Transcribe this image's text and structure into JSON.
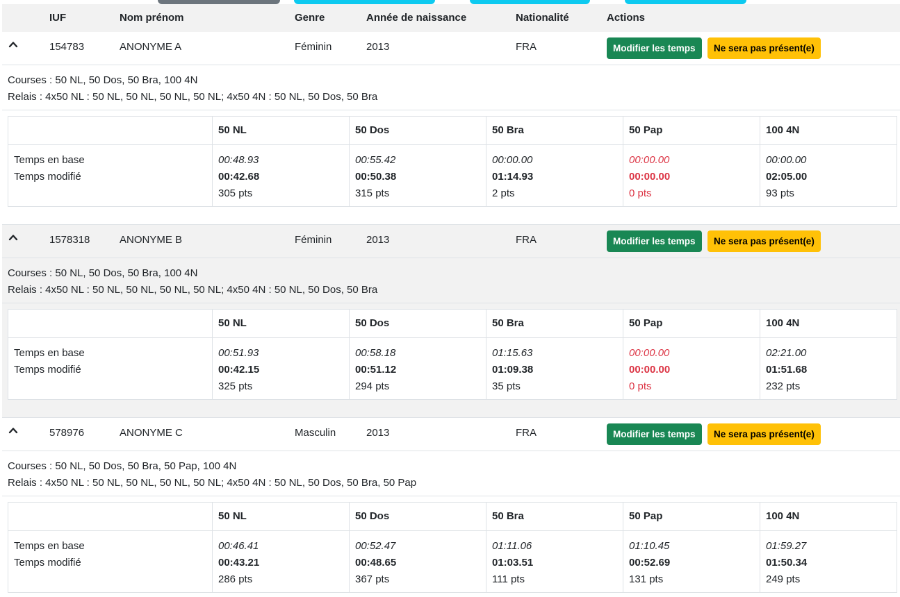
{
  "top_tabs": [
    {
      "color": "#6c757d"
    },
    {
      "color": "#0dcaf0"
    },
    {
      "color": "#0dcaf0"
    },
    {
      "color": "#0dcaf0"
    }
  ],
  "header": {
    "iuf": "IUF",
    "name": "Nom prénom",
    "gender": "Genre",
    "birth_year": "Année de naissance",
    "nationality": "Nationalité",
    "actions": "Actions"
  },
  "athletes": [
    {
      "iuf": "154783",
      "name": "ANONYME A",
      "gender": "Féminin",
      "birth_year": "2013",
      "nationality": "FRA",
      "edit_label": "Modifier les temps",
      "absent_label": "Ne sera pas présent(e)",
      "courses": "Courses : 50 NL, 50 Dos, 50 Bra, 100 4N",
      "relais": "Relais : 4x50 NL : 50 NL, 50 NL, 50 NL, 50 NL; 4x50 4N : 50 NL, 50 Dos, 50 Bra",
      "row_label_base": "Temps en base",
      "row_label_mod": "Temps modifié",
      "events": [
        {
          "name": "50 NL",
          "base": "00:48.93",
          "mod": "00:42.68",
          "pts": "305 pts",
          "absent": false
        },
        {
          "name": "50 Dos",
          "base": "00:55.42",
          "mod": "00:50.38",
          "pts": "315 pts",
          "absent": false
        },
        {
          "name": "50 Bra",
          "base": "00:00.00",
          "mod": "01:14.93",
          "pts": "2 pts",
          "absent": false
        },
        {
          "name": "50 Pap",
          "base": "00:00.00",
          "mod": "00:00.00",
          "pts": "0 pts",
          "absent": true
        },
        {
          "name": "100 4N",
          "base": "00:00.00",
          "mod": "02:05.00",
          "pts": "93 pts",
          "absent": false
        }
      ]
    },
    {
      "iuf": "1578318",
      "name": "ANONYME B",
      "gender": "Féminin",
      "birth_year": "2013",
      "nationality": "FRA",
      "edit_label": "Modifier les temps",
      "absent_label": "Ne sera pas présent(e)",
      "courses": "Courses : 50 NL, 50 Dos, 50 Bra, 100 4N",
      "relais": "Relais : 4x50 NL : 50 NL, 50 NL, 50 NL, 50 NL; 4x50 4N : 50 NL, 50 Dos, 50 Bra",
      "row_label_base": "Temps en base",
      "row_label_mod": "Temps modifié",
      "events": [
        {
          "name": "50 NL",
          "base": "00:51.93",
          "mod": "00:42.15",
          "pts": "325 pts",
          "absent": false
        },
        {
          "name": "50 Dos",
          "base": "00:58.18",
          "mod": "00:51.12",
          "pts": "294 pts",
          "absent": false
        },
        {
          "name": "50 Bra",
          "base": "01:15.63",
          "mod": "01:09.38",
          "pts": "35 pts",
          "absent": false
        },
        {
          "name": "50 Pap",
          "base": "00:00.00",
          "mod": "00:00.00",
          "pts": "0 pts",
          "absent": true
        },
        {
          "name": "100 4N",
          "base": "02:21.00",
          "mod": "01:51.68",
          "pts": "232 pts",
          "absent": false
        }
      ]
    },
    {
      "iuf": "578976",
      "name": "ANONYME C",
      "gender": "Masculin",
      "birth_year": "2013",
      "nationality": "FRA",
      "edit_label": "Modifier les temps",
      "absent_label": "Ne sera pas présent(e)",
      "courses": "Courses : 50 NL, 50 Dos, 50 Bra, 50 Pap, 100 4N",
      "relais": "Relais : 4x50 NL : 50 NL, 50 NL, 50 NL, 50 NL; 4x50 4N : 50 NL, 50 Dos, 50 Bra, 50 Pap",
      "row_label_base": "Temps en base",
      "row_label_mod": "Temps modifié",
      "events": [
        {
          "name": "50 NL",
          "base": "00:46.41",
          "mod": "00:43.21",
          "pts": "286 pts",
          "absent": false
        },
        {
          "name": "50 Dos",
          "base": "00:52.47",
          "mod": "00:48.65",
          "pts": "367 pts",
          "absent": false
        },
        {
          "name": "50 Bra",
          "base": "01:11.06",
          "mod": "01:03.51",
          "pts": "111 pts",
          "absent": false
        },
        {
          "name": "50 Pap",
          "base": "01:10.45",
          "mod": "00:52.69",
          "pts": "131 pts",
          "absent": false
        },
        {
          "name": "100 4N",
          "base": "01:59.27",
          "mod": "01:50.34",
          "pts": "249 pts",
          "absent": false
        }
      ]
    }
  ]
}
